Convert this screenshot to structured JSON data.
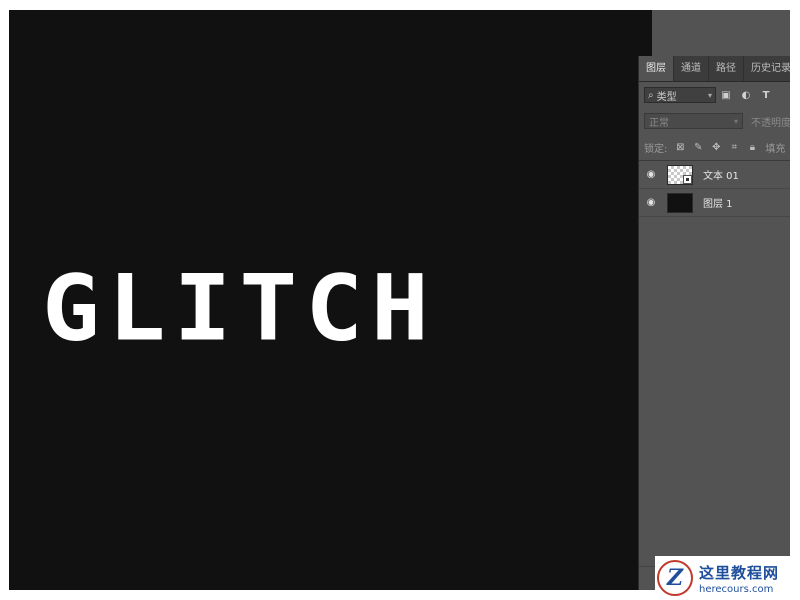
{
  "canvas": {
    "text": "GLITCH",
    "background": "#111111",
    "text_color": "#ffffff"
  },
  "layers_panel": {
    "tabs": [
      "图层",
      "通道",
      "路径",
      "历史记录"
    ],
    "active_tab": "图层",
    "filter": {
      "icon": "search-icon",
      "label": "类型"
    },
    "filter_icons": [
      "image-filter-icon",
      "adjustment-filter-icon",
      "type-filter-icon"
    ],
    "blend_mode": "正常",
    "opacity_label": "不透明度",
    "lock_label": "锁定:",
    "lock_icons": [
      "lock-transparent-icon",
      "lock-paint-icon",
      "lock-position-icon",
      "lock-artboard-icon",
      "lock-all-icon"
    ],
    "fill_label": "填充",
    "layers": [
      {
        "name": "文本 01",
        "visible": true,
        "thumbnail": "smart-object"
      },
      {
        "name": "图层 1",
        "visible": true,
        "thumbnail": "black-fill"
      }
    ],
    "footer_icons": [
      "link-icon",
      "fx-icon",
      "mask-icon",
      "adjustment-icon",
      "folder-icon"
    ]
  },
  "watermark": {
    "logo_letter": "Z",
    "title": "这里教程网",
    "url": "herecours.com"
  }
}
